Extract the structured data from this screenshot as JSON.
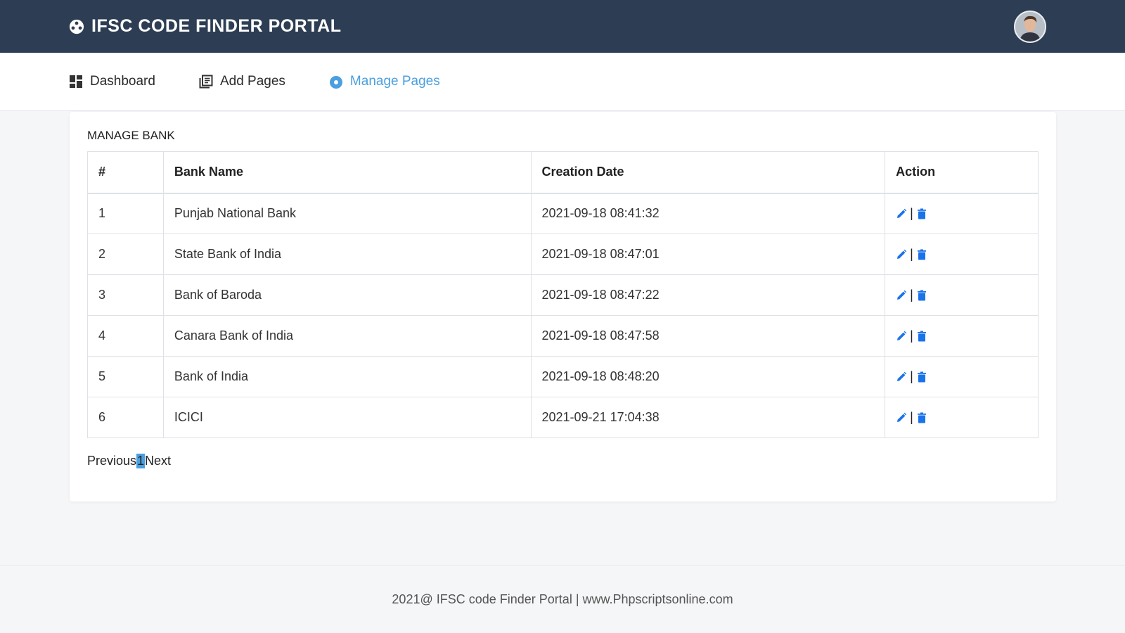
{
  "header": {
    "title": "IFSC CODE FINDER PORTAL",
    "brand_icon": "life-ring-icon",
    "avatar": "user-avatar"
  },
  "nav": {
    "items": [
      {
        "label": "Dashboard",
        "icon": "dashboard-icon"
      },
      {
        "label": "Add Pages",
        "icon": "pages-icon"
      },
      {
        "label": "Manage Pages",
        "icon": "radio-circle-icon",
        "active": true
      }
    ]
  },
  "main": {
    "title": "MANAGE BANK",
    "table": {
      "headers": [
        "#",
        "Bank Name",
        "Creation Date",
        "Action"
      ],
      "rows": [
        {
          "num": "1",
          "name": "Punjab National Bank",
          "date": "2021-09-18 08:41:32"
        },
        {
          "num": "2",
          "name": "State Bank of India",
          "date": "2021-09-18 08:47:01"
        },
        {
          "num": "3",
          "name": "Bank of Baroda",
          "date": "2021-09-18 08:47:22"
        },
        {
          "num": "4",
          "name": "Canara Bank of India",
          "date": "2021-09-18 08:47:58"
        },
        {
          "num": "5",
          "name": "Bank of India",
          "date": "2021-09-18 08:48:20"
        },
        {
          "num": "6",
          "name": "ICICI",
          "date": "2021-09-21 17:04:38"
        }
      ],
      "action_separator": "|"
    },
    "pagination": {
      "previous": "Previous",
      "current": "1",
      "next": "Next"
    }
  },
  "footer": {
    "text": "2021@ IFSC code Finder Portal | www.Phpscriptsonline.com"
  },
  "colors": {
    "header_bg": "#2d3e54",
    "accent": "#4a9fe0",
    "action_icon": "#1a73e8"
  }
}
